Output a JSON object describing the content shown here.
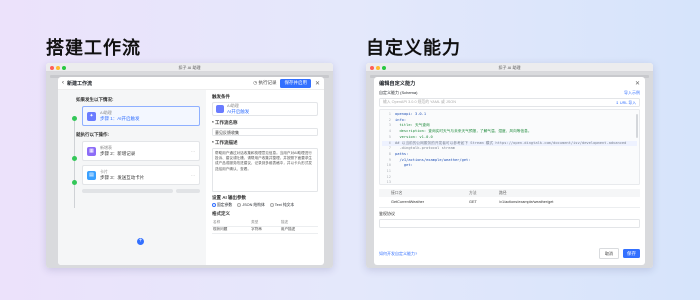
{
  "left": {
    "heading": "搭建工作流",
    "window_title": "扣子 AI 助理",
    "panel": {
      "back": "‹",
      "title": "新建工作流",
      "history": "执行记录",
      "publish": "保存并启用",
      "close": "✕"
    },
    "trigger_section": "如果发生以下情况:",
    "trigger_card": {
      "kind": "AI助理",
      "step": "步骤 1：AI开启触发"
    },
    "action_section": "就执行以下操作:",
    "action_cards": [
      {
        "kind": "新增表",
        "step": "步骤 2：新增记录"
      },
      {
        "kind": "卡片",
        "step": "步骤 3：发送互动卡片"
      }
    ],
    "props": {
      "trigger_title": "触发条件",
      "trigger_kind": "AI助理",
      "trigger_step": "AI开启触发",
      "name_label": "* 工作流名称",
      "name_value": "意见反馈收集",
      "desc_label": "* 工作流描述",
      "desc_value": "帮助用户通过对话收集和梳理意见信息。当用户对AI助理进行投诉、建议或吐槽，请帮用户收集并整理，并按照下面要求生成产品或服务改进建议，记录到多维表格中，并以卡片形式发送给用户确认、查看。",
      "output_label": "设置 AI 输出参数",
      "output_options": [
        "固定参数",
        "JSON 结构体",
        "Text 纯文本"
      ],
      "table_label": "格式定义",
      "table_headers": [
        "名称",
        "类型",
        "描述"
      ],
      "table_rows": [
        [
          "现状问题",
          "字符串",
          "用户描述"
        ]
      ]
    },
    "add_button": "+"
  },
  "right": {
    "heading": "自定义能力",
    "window_title": "扣子 AI 助理",
    "panel": {
      "title": "编辑自定义能力",
      "close": "✕",
      "schema_label": "自定义能力 (Schema)",
      "import_link": "导入示例",
      "schema_placeholder": "输入 OpenAPI 3.0.0 规范的 YAML 或 JSON",
      "url_button": "⇓ URL 导入"
    },
    "code_lines": [
      {
        "no": "1",
        "text": "openapi: 3.0.1"
      },
      {
        "no": "2",
        "text": "info:"
      },
      {
        "no": "3",
        "text": "  title: 天气查询"
      },
      {
        "no": "4",
        "text": "  description: 查询实时天气与未来天气预报，了解气温、湿度、风向等信息。"
      },
      {
        "no": "5",
        "text": "  version: v1.0.0"
      },
      {
        "no": "6",
        "text": "## 以当前的公网服务的开发者可以参考如下 Stream 模式 https://open.dingtalk.com/document/isv/development-advanced"
      },
      {
        "no": "7",
        "text": "  -dingtalk-protocol stream"
      },
      {
        "no": "8",
        "text": "paths:"
      },
      {
        "no": "9",
        "text": "  /v1/actions/example/weather/get:"
      },
      {
        "no": "10",
        "text": "    get:"
      },
      {
        "no": "11",
        "text": ""
      },
      {
        "no": "12",
        "text": ""
      },
      {
        "no": "13",
        "text": ""
      }
    ],
    "tools_headers": [
      "接口名",
      "方法",
      "路径"
    ],
    "tools_rows": [
      [
        "GetCurrentWeather",
        "GET",
        "/v1/actions/example/weather/get"
      ]
    ],
    "auth_label": "鉴权协议",
    "footer_link": "如何开发自定义能力?",
    "cancel": "取消",
    "confirm": "保存"
  },
  "colors": {
    "accent": "#3370ff",
    "success": "#34c759"
  }
}
